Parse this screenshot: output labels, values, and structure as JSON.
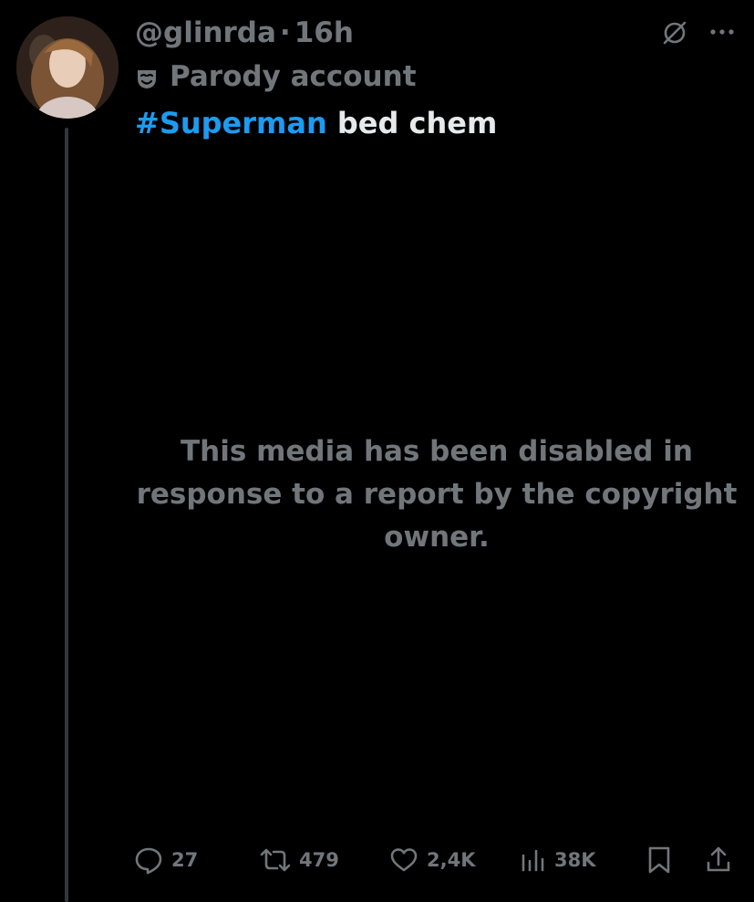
{
  "tweet": {
    "handle": "@glinrda",
    "separator": "·",
    "time": "16h",
    "parody_label": "Parody account",
    "hashtag": "#Superman",
    "text": " bed chem",
    "media_notice": "This media has been disabled in response to a report by the copyright owner."
  },
  "actions": {
    "replies": "27",
    "reposts": "479",
    "likes": "2,4K",
    "views": "38K"
  },
  "icons": {
    "header": [
      "grok-icon",
      "more-icon"
    ],
    "actions": [
      "reply-icon",
      "repost-icon",
      "like-icon",
      "views-icon",
      "bookmark-icon",
      "share-icon"
    ],
    "badge": "parody-mask-icon"
  },
  "colors": {
    "background": "#000000",
    "text_primary": "#e7e9ea",
    "text_secondary": "#71767b",
    "link": "#1d9bf0",
    "thread_line": "#333639"
  }
}
